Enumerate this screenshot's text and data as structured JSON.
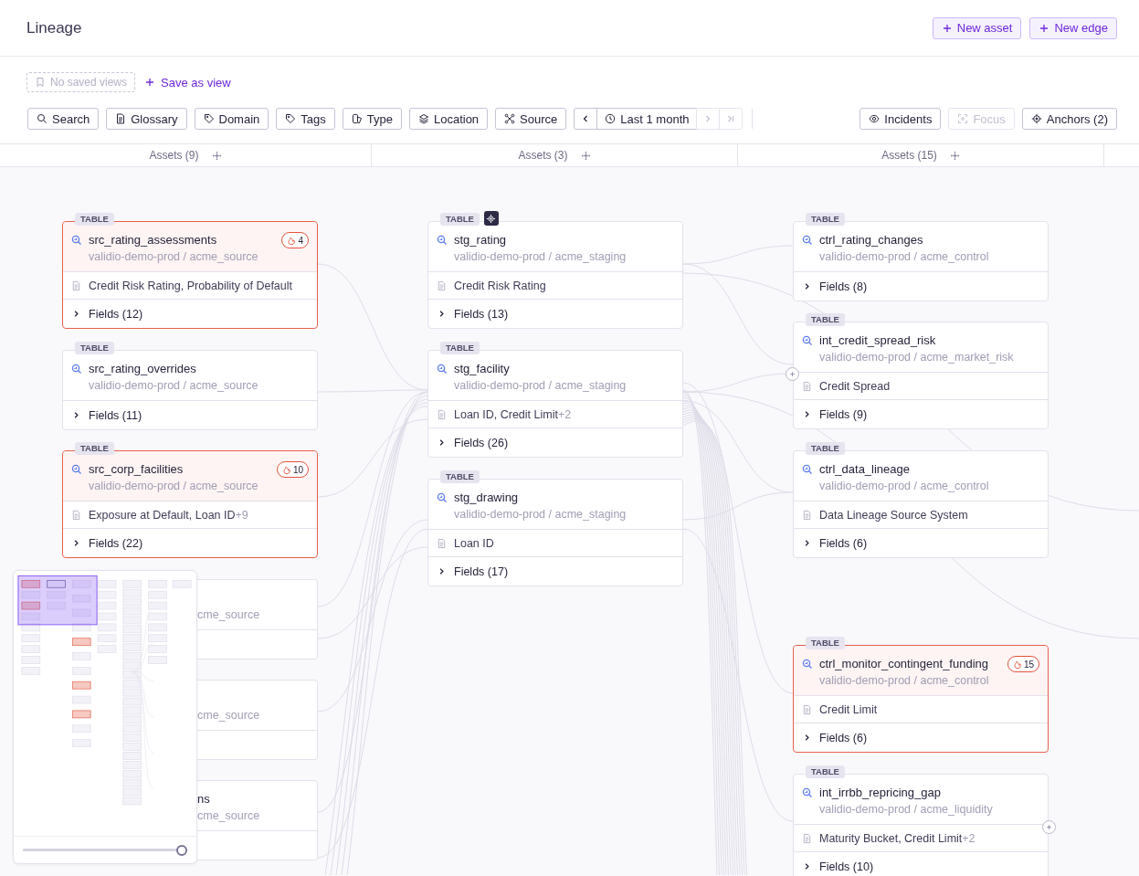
{
  "page": {
    "title": "Lineage"
  },
  "header_actions": [
    {
      "label": "New asset"
    },
    {
      "label": "New edge"
    }
  ],
  "saved_views": {
    "placeholder": "No saved views",
    "save_label": "Save as view"
  },
  "filters": [
    {
      "label": "Search",
      "kind": "search"
    },
    {
      "label": "Glossary",
      "kind": "doc"
    },
    {
      "label": "Domain",
      "kind": "tag"
    },
    {
      "label": "Tags",
      "kind": "tag"
    },
    {
      "label": "Type",
      "kind": "type"
    },
    {
      "label": "Location",
      "kind": "layers"
    },
    {
      "label": "Source",
      "kind": "source"
    }
  ],
  "time_range": {
    "label": "Last 1 month",
    "prev_disabled": false,
    "next_disabled": true,
    "last_disabled": true
  },
  "view_buttons": [
    {
      "label": "Incidents",
      "kind": "eye",
      "disabled": false
    },
    {
      "label": "Focus",
      "kind": "focus",
      "disabled": true
    },
    {
      "label": "Anchors (2)",
      "kind": "anchor",
      "disabled": false
    }
  ],
  "columns": [
    {
      "title": "Assets (9)",
      "cards": [
        {
          "kind": "full",
          "tag": "TABLE",
          "name": "src_rating_assessments",
          "path": "validio-demo-prod / acme_source",
          "incidents": "4",
          "glossary": "Credit Risk Rating,  Probability of Default",
          "fields": "Fields (12)"
        },
        {
          "kind": "full",
          "tag": "TABLE",
          "name": "src_rating_overrides",
          "path": "validio-demo-prod / acme_source",
          "fields": "Fields (11)"
        },
        {
          "kind": "full",
          "tag": "TABLE",
          "name": "src_corp_facilities",
          "path": "validio-demo-prod / acme_source",
          "incidents": "10",
          "glossary": "Exposure at Default,  Loan ID",
          "glossary_more": "+9",
          "fields": "Fields (22)"
        },
        {
          "kind": "partial",
          "path": "cme_source"
        },
        {
          "kind": "partial",
          "path": "cme_source"
        },
        {
          "kind": "partial",
          "name": "ns",
          "path": "cme_source"
        }
      ]
    },
    {
      "title": "Assets (3)",
      "cards": [
        {
          "kind": "full",
          "tag": "TABLE",
          "anchored": true,
          "name": "stg_rating",
          "path": "validio-demo-prod / acme_staging",
          "glossary": "Credit Risk Rating",
          "fields": "Fields (13)"
        },
        {
          "kind": "full",
          "tag": "TABLE",
          "name": "stg_facility",
          "path": "validio-demo-prod / acme_staging",
          "glossary": "Loan ID,  Credit Limit",
          "glossary_more": "+2",
          "fields": "Fields (26)"
        },
        {
          "kind": "full",
          "tag": "TABLE",
          "name": "stg_drawing",
          "path": "validio-demo-prod / acme_staging",
          "glossary": "Loan ID",
          "fields": "Fields (17)"
        }
      ]
    },
    {
      "title": "Assets (15)",
      "cards": [
        {
          "kind": "full",
          "tag": "TABLE",
          "name": "ctrl_rating_changes",
          "path": "validio-demo-prod / acme_control",
          "fields": "Fields (8)"
        },
        {
          "kind": "full",
          "tag": "TABLE",
          "name": "int_credit_spread_risk",
          "path": "validio-demo-prod / acme_market_risk",
          "glossary": "Credit Spread",
          "fields": "Fields (9)",
          "expand_left": true
        },
        {
          "kind": "full",
          "tag": "TABLE",
          "name": "ctrl_data_lineage",
          "path": "validio-demo-prod / acme_control",
          "glossary": "Data Lineage Source System",
          "fields": "Fields (6)"
        },
        {
          "kind": "full",
          "tag": "TABLE",
          "name": "ctrl_monitor_contingent_funding",
          "path": "validio-demo-prod / acme_control",
          "incidents": "15",
          "glossary": "Credit Limit",
          "fields": "Fields (6)"
        },
        {
          "kind": "full",
          "tag": "TABLE",
          "name": "int_irrbb_repricing_gap",
          "path": "validio-demo-prod / acme_liquidity",
          "glossary": "Maturity Bucket,  Credit Limit",
          "glossary_more": "+2",
          "fields": "Fields (10)",
          "expand_right": true
        }
      ]
    }
  ],
  "minimap": {
    "zoom": {
      "level": 1
    }
  }
}
